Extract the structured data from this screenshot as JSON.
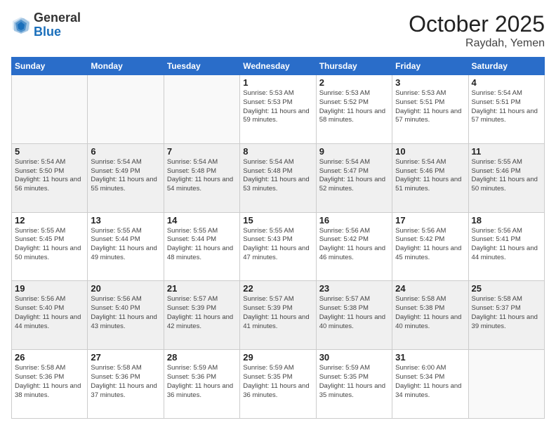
{
  "header": {
    "logo_general": "General",
    "logo_blue": "Blue",
    "month_title": "October 2025",
    "location": "Raydah, Yemen"
  },
  "days_of_week": [
    "Sunday",
    "Monday",
    "Tuesday",
    "Wednesday",
    "Thursday",
    "Friday",
    "Saturday"
  ],
  "weeks": [
    [
      {
        "day": "",
        "info": ""
      },
      {
        "day": "",
        "info": ""
      },
      {
        "day": "",
        "info": ""
      },
      {
        "day": "1",
        "info": "Sunrise: 5:53 AM\nSunset: 5:53 PM\nDaylight: 11 hours and 59 minutes."
      },
      {
        "day": "2",
        "info": "Sunrise: 5:53 AM\nSunset: 5:52 PM\nDaylight: 11 hours and 58 minutes."
      },
      {
        "day": "3",
        "info": "Sunrise: 5:53 AM\nSunset: 5:51 PM\nDaylight: 11 hours and 57 minutes."
      },
      {
        "day": "4",
        "info": "Sunrise: 5:54 AM\nSunset: 5:51 PM\nDaylight: 11 hours and 57 minutes."
      }
    ],
    [
      {
        "day": "5",
        "info": "Sunrise: 5:54 AM\nSunset: 5:50 PM\nDaylight: 11 hours and 56 minutes."
      },
      {
        "day": "6",
        "info": "Sunrise: 5:54 AM\nSunset: 5:49 PM\nDaylight: 11 hours and 55 minutes."
      },
      {
        "day": "7",
        "info": "Sunrise: 5:54 AM\nSunset: 5:48 PM\nDaylight: 11 hours and 54 minutes."
      },
      {
        "day": "8",
        "info": "Sunrise: 5:54 AM\nSunset: 5:48 PM\nDaylight: 11 hours and 53 minutes."
      },
      {
        "day": "9",
        "info": "Sunrise: 5:54 AM\nSunset: 5:47 PM\nDaylight: 11 hours and 52 minutes."
      },
      {
        "day": "10",
        "info": "Sunrise: 5:54 AM\nSunset: 5:46 PM\nDaylight: 11 hours and 51 minutes."
      },
      {
        "day": "11",
        "info": "Sunrise: 5:55 AM\nSunset: 5:46 PM\nDaylight: 11 hours and 50 minutes."
      }
    ],
    [
      {
        "day": "12",
        "info": "Sunrise: 5:55 AM\nSunset: 5:45 PM\nDaylight: 11 hours and 50 minutes."
      },
      {
        "day": "13",
        "info": "Sunrise: 5:55 AM\nSunset: 5:44 PM\nDaylight: 11 hours and 49 minutes."
      },
      {
        "day": "14",
        "info": "Sunrise: 5:55 AM\nSunset: 5:44 PM\nDaylight: 11 hours and 48 minutes."
      },
      {
        "day": "15",
        "info": "Sunrise: 5:55 AM\nSunset: 5:43 PM\nDaylight: 11 hours and 47 minutes."
      },
      {
        "day": "16",
        "info": "Sunrise: 5:56 AM\nSunset: 5:42 PM\nDaylight: 11 hours and 46 minutes."
      },
      {
        "day": "17",
        "info": "Sunrise: 5:56 AM\nSunset: 5:42 PM\nDaylight: 11 hours and 45 minutes."
      },
      {
        "day": "18",
        "info": "Sunrise: 5:56 AM\nSunset: 5:41 PM\nDaylight: 11 hours and 44 minutes."
      }
    ],
    [
      {
        "day": "19",
        "info": "Sunrise: 5:56 AM\nSunset: 5:40 PM\nDaylight: 11 hours and 44 minutes."
      },
      {
        "day": "20",
        "info": "Sunrise: 5:56 AM\nSunset: 5:40 PM\nDaylight: 11 hours and 43 minutes."
      },
      {
        "day": "21",
        "info": "Sunrise: 5:57 AM\nSunset: 5:39 PM\nDaylight: 11 hours and 42 minutes."
      },
      {
        "day": "22",
        "info": "Sunrise: 5:57 AM\nSunset: 5:39 PM\nDaylight: 11 hours and 41 minutes."
      },
      {
        "day": "23",
        "info": "Sunrise: 5:57 AM\nSunset: 5:38 PM\nDaylight: 11 hours and 40 minutes."
      },
      {
        "day": "24",
        "info": "Sunrise: 5:58 AM\nSunset: 5:38 PM\nDaylight: 11 hours and 40 minutes."
      },
      {
        "day": "25",
        "info": "Sunrise: 5:58 AM\nSunset: 5:37 PM\nDaylight: 11 hours and 39 minutes."
      }
    ],
    [
      {
        "day": "26",
        "info": "Sunrise: 5:58 AM\nSunset: 5:36 PM\nDaylight: 11 hours and 38 minutes."
      },
      {
        "day": "27",
        "info": "Sunrise: 5:58 AM\nSunset: 5:36 PM\nDaylight: 11 hours and 37 minutes."
      },
      {
        "day": "28",
        "info": "Sunrise: 5:59 AM\nSunset: 5:36 PM\nDaylight: 11 hours and 36 minutes."
      },
      {
        "day": "29",
        "info": "Sunrise: 5:59 AM\nSunset: 5:35 PM\nDaylight: 11 hours and 36 minutes."
      },
      {
        "day": "30",
        "info": "Sunrise: 5:59 AM\nSunset: 5:35 PM\nDaylight: 11 hours and 35 minutes."
      },
      {
        "day": "31",
        "info": "Sunrise: 6:00 AM\nSunset: 5:34 PM\nDaylight: 11 hours and 34 minutes."
      },
      {
        "day": "",
        "info": ""
      }
    ]
  ]
}
